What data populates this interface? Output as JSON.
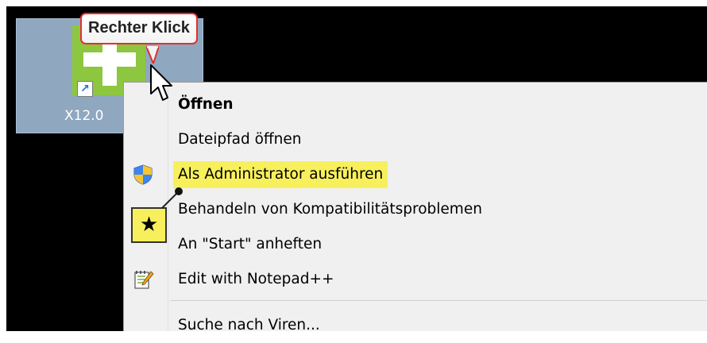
{
  "callout": {
    "text": "Rechter Klick"
  },
  "shortcut": {
    "label": "X12.0"
  },
  "context_menu": {
    "items": [
      {
        "label": "Öffnen",
        "bold": true,
        "icon": null
      },
      {
        "label": "Dateipfad öffnen",
        "icon": null
      },
      {
        "label": "Als Administrator ausführen",
        "icon": "uac-shield-icon",
        "highlight": true
      },
      {
        "label": "Behandeln von Kompatibilitätsproblemen",
        "icon": null
      },
      {
        "label": "An \"Start\" anheften",
        "icon": null
      },
      {
        "label": "Edit with Notepad++",
        "icon": "notepad-plus-plus-icon"
      },
      {
        "label": "Suche nach Viren...",
        "icon": null
      }
    ]
  },
  "annotation": {
    "symbol": "★"
  },
  "colors": {
    "highlight": "#f7f05c",
    "callout_border": "#e03030",
    "selection": "#8fa7bf"
  }
}
